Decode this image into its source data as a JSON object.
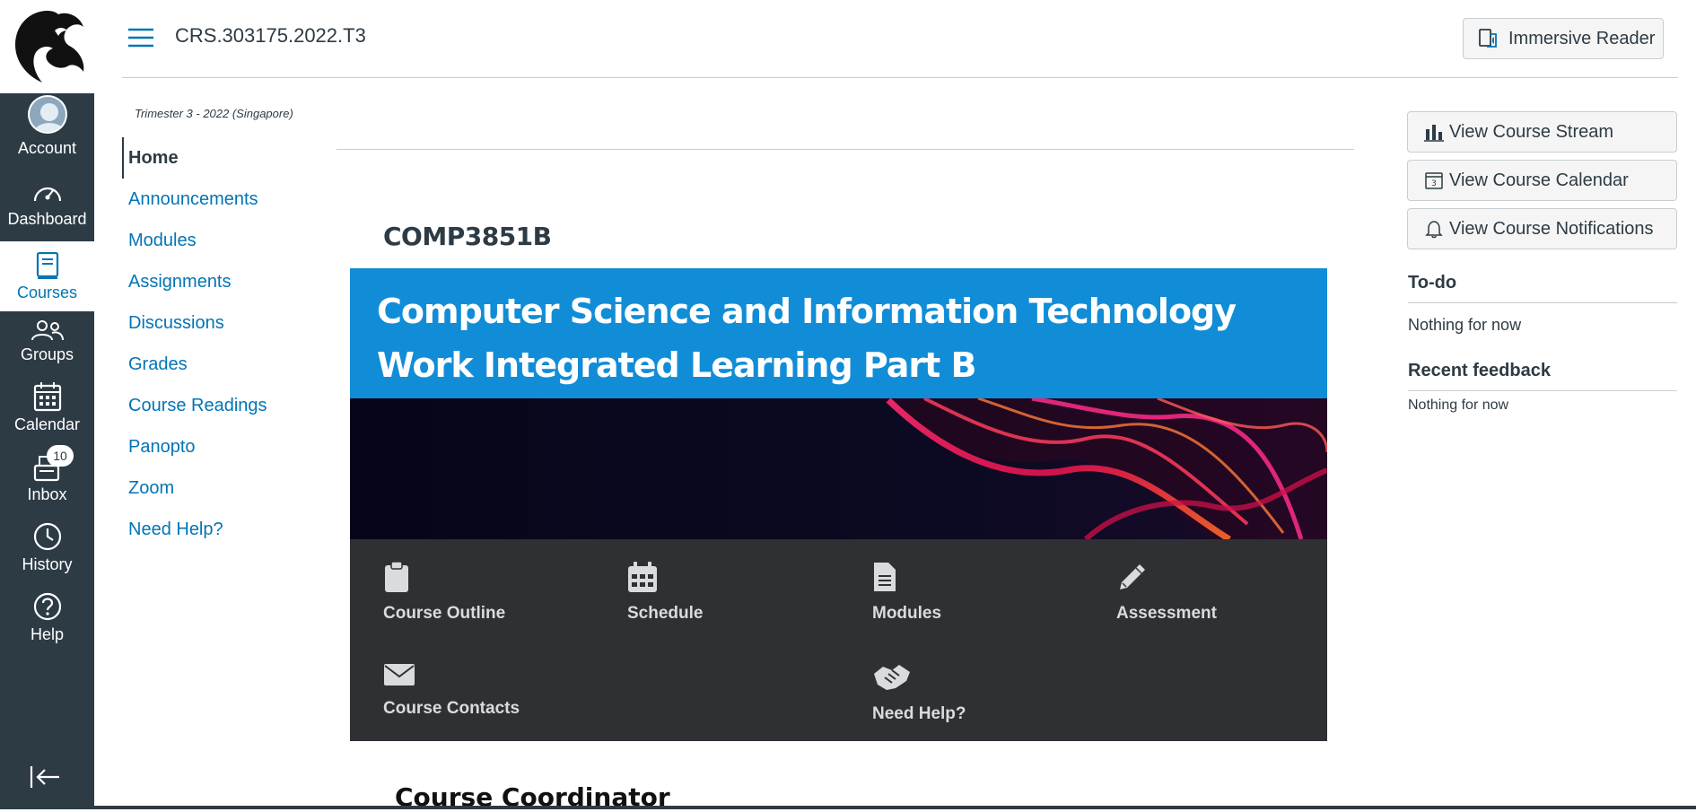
{
  "header": {
    "course_id": "CRS.303175.2022.T3",
    "immersive_reader_label": "Immersive Reader"
  },
  "global_nav": {
    "items": [
      {
        "label": "Account",
        "icon": "account-avatar"
      },
      {
        "label": "Dashboard",
        "icon": "dashboard-icon"
      },
      {
        "label": "Courses",
        "icon": "courses-icon"
      },
      {
        "label": "Groups",
        "icon": "groups-icon"
      },
      {
        "label": "Calendar",
        "icon": "calendar-icon"
      },
      {
        "label": "Inbox",
        "icon": "inbox-icon"
      },
      {
        "label": "History",
        "icon": "history-icon"
      },
      {
        "label": "Help",
        "icon": "help-icon"
      }
    ],
    "inbox_badge": "10",
    "active_color": "#0374b5",
    "background_color": "#2d3b45"
  },
  "course_nav": {
    "term": "Trimester 3 - 2022 (Singapore)",
    "items": [
      "Home",
      "Announcements",
      "Modules",
      "Assignments",
      "Discussions",
      "Grades",
      "Course Readings",
      "Panopto",
      "Zoom",
      "Need Help?"
    ],
    "active": "Home"
  },
  "main": {
    "course_code": "COMP3851B",
    "banner_title": "Computer Science and Information Technology Work Integrated Learning Part B",
    "banner_color": "#118dd7",
    "tiles": [
      {
        "label": "Course Outline",
        "icon": "clipboard-icon"
      },
      {
        "label": "Schedule",
        "icon": "calendar-grid-icon"
      },
      {
        "label": "Modules",
        "icon": "document-icon"
      },
      {
        "label": "Assessment",
        "icon": "pencil-icon"
      },
      {
        "label": "Course Contacts",
        "icon": "envelope-icon"
      },
      {
        "label": "Need Help?",
        "icon": "handshake-icon"
      }
    ],
    "section_heading": "Course Coordinator"
  },
  "sidebar": {
    "buttons": [
      {
        "label": "View Course Stream",
        "icon": "bar-chart-icon"
      },
      {
        "label": "View Course Calendar",
        "icon": "calendar-day-icon"
      },
      {
        "label": "View Course Notifications",
        "icon": "bell-icon"
      }
    ],
    "todo_heading": "To-do",
    "todo_text": "Nothing for now",
    "feedback_heading": "Recent feedback",
    "feedback_text": "Nothing for now"
  }
}
